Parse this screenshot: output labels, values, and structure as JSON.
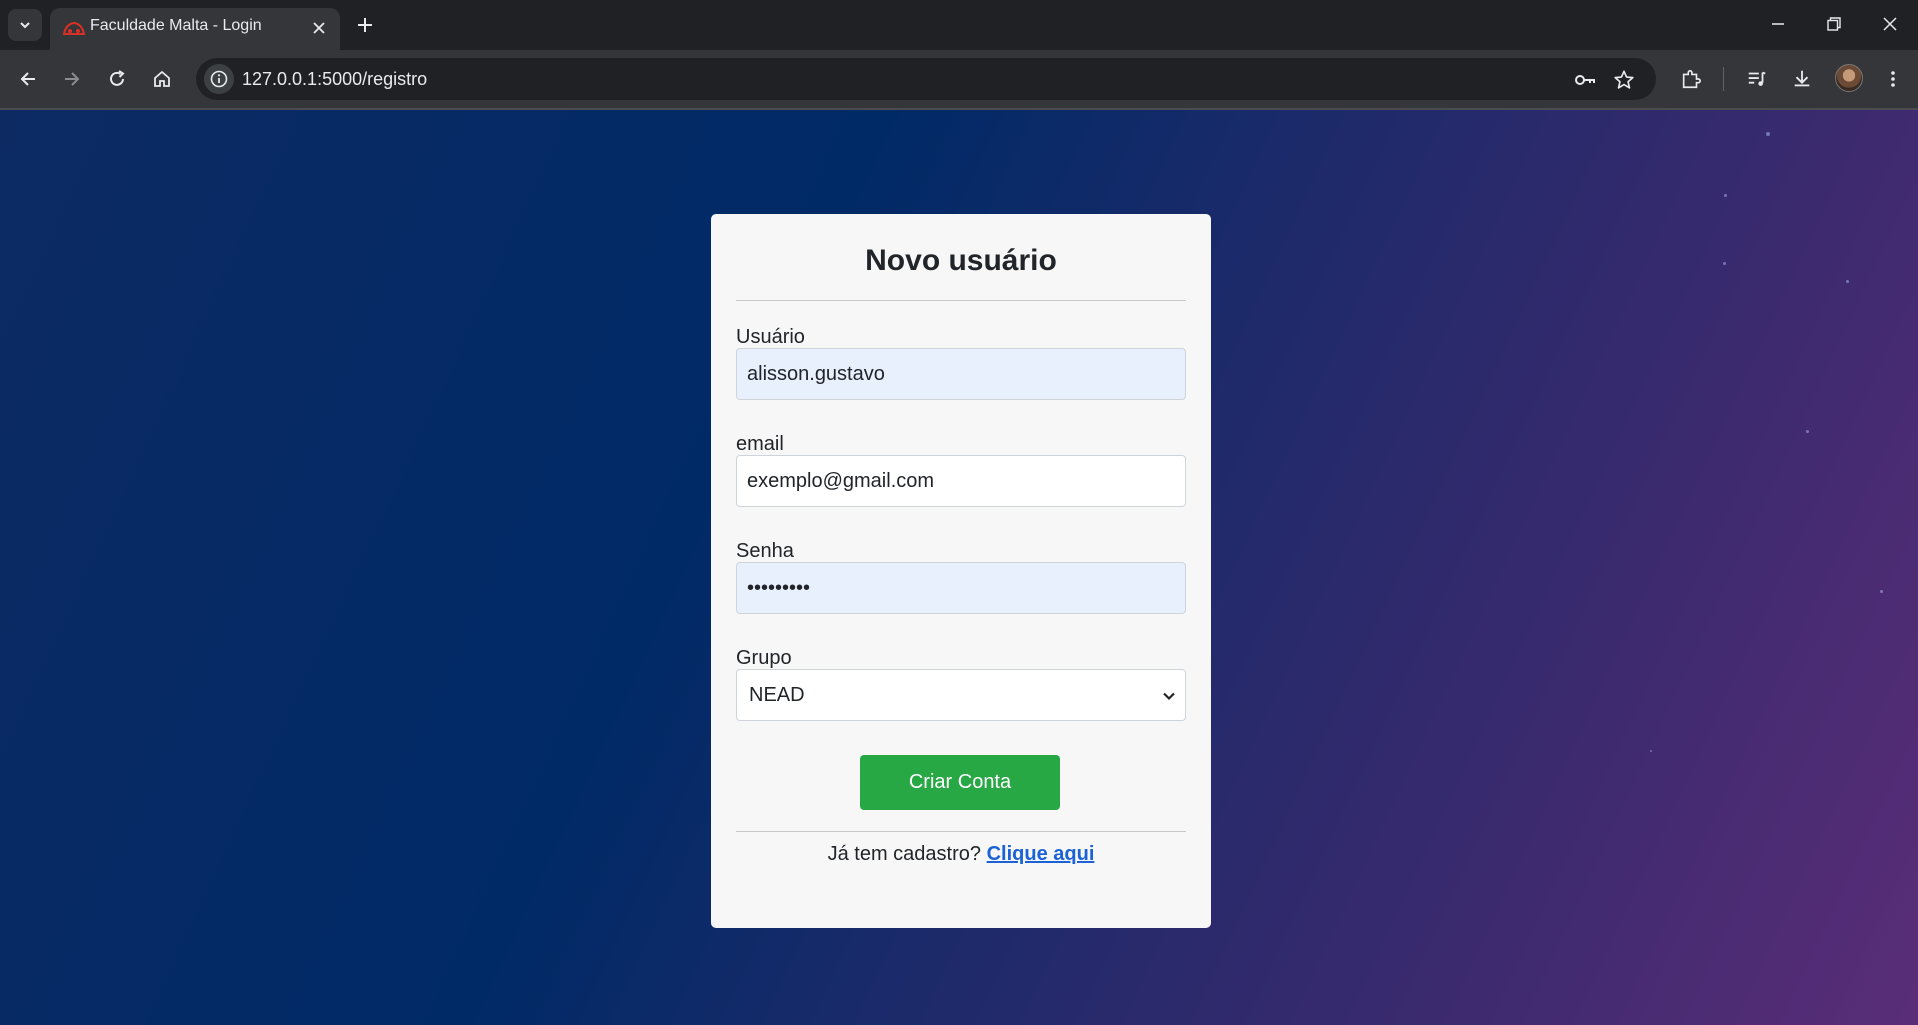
{
  "browser": {
    "tab": {
      "title": "Faculdade Malta - Login"
    },
    "url": "127.0.0.1:5000/registro"
  },
  "form": {
    "title": "Novo usuário",
    "username": {
      "label": "Usuário",
      "value": "alisson.gustavo"
    },
    "email": {
      "label": "email",
      "value": "exemplo@gmail.com"
    },
    "password": {
      "label": "Senha",
      "value": "•••••••••"
    },
    "group": {
      "label": "Grupo",
      "selected": "NEAD"
    },
    "submit_label": "Criar Conta",
    "footer": {
      "prompt": "Já tem cadastro?",
      "link": "Clique aqui"
    }
  },
  "colors": {
    "submit_button": "#28a745",
    "link": "#1a62d6",
    "autofill_background": "#e8f0fe",
    "card_background": "#f7f7f7"
  }
}
